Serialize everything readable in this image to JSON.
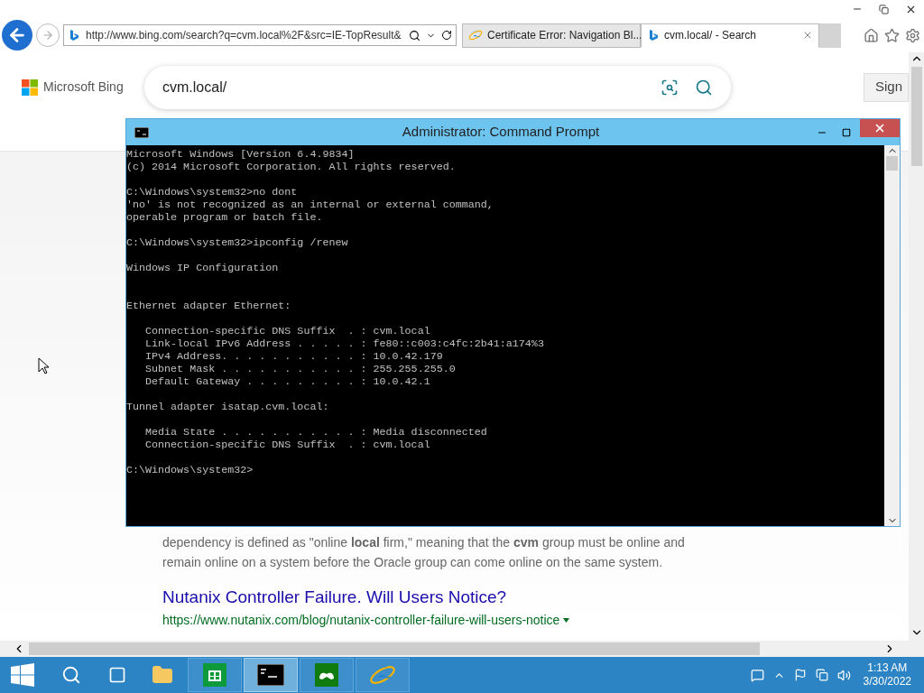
{
  "browser": {
    "address": "http://www.bing.com/search?q=cvm.local%2F&src=IE-TopResult&",
    "tabs": [
      {
        "title": "Certificate Error: Navigation Bl...",
        "selected": false,
        "kind": "ie"
      },
      {
        "title": "cvm.local/ - Search",
        "selected": true,
        "kind": "bing"
      }
    ]
  },
  "bing": {
    "logo": "Microsoft Bing",
    "query": "cvm.local/",
    "sign_in": "Sign"
  },
  "results": {
    "snippet": [
      "dependency is defined as \"online **local** firm,\" meaning that the **cvm** group must be online and",
      "remain online on a system before the Oracle group can come online on the same system."
    ],
    "title": "Nutanix Controller Failure. Will Users Notice?",
    "url": "https://www.nutanix.com/blog/nutanix-controller-failure-will-users-notice"
  },
  "console": {
    "title": "Administrator: Command Prompt",
    "text": "Microsoft Windows [Version 6.4.9834]\n(c) 2014 Microsoft Corporation. All rights reserved.\n\nC:\\Windows\\system32>no dont\n'no' is not recognized as an internal or external command,\noperable program or batch file.\n\nC:\\Windows\\system32>ipconfig /renew\n\nWindows IP Configuration\n\n\nEthernet adapter Ethernet:\n\n   Connection-specific DNS Suffix  . : cvm.local\n   Link-local IPv6 Address . . . . . : fe80::c003:c4fc:2b41:a174%3\n   IPv4 Address. . . . . . . . . . . : 10.0.42.179\n   Subnet Mask . . . . . . . . . . . : 255.255.255.0\n   Default Gateway . . . . . . . . . : 10.0.42.1\n\nTunnel adapter isatap.cvm.local:\n\n   Media State . . . . . . . . . . . : Media disconnected\n   Connection-specific DNS Suffix  . : cvm.local\n\nC:\\Windows\\system32>"
  },
  "taskbar": {
    "apps": [
      {
        "kind": "store",
        "selected": false
      },
      {
        "kind": "cmd",
        "selected": true
      },
      {
        "kind": "xbox",
        "selected": false
      },
      {
        "kind": "ie",
        "selected": false
      }
    ],
    "time": "1:13 AM",
    "date": "3/30/2022"
  }
}
